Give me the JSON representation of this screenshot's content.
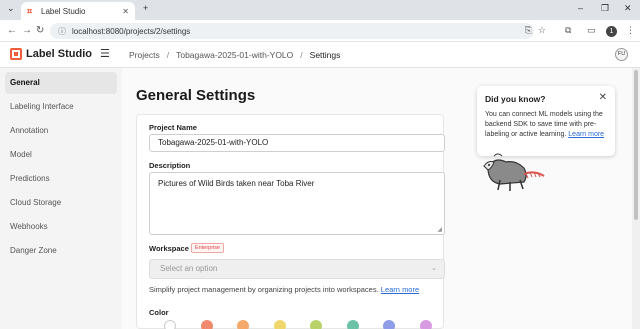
{
  "browser": {
    "tab_title": "Label Studio",
    "url": "localhost:8080/projects/2/settings",
    "profile_initial": "1"
  },
  "app": {
    "logo_text": "Label Studio",
    "breadcrumb": [
      "Projects",
      "Tobagawa-2025-01-with-YOLO",
      "Settings"
    ],
    "avatar_initials": "FU"
  },
  "sidebar": {
    "items": [
      {
        "label": "General",
        "active": true
      },
      {
        "label": "Labeling Interface"
      },
      {
        "label": "Annotation"
      },
      {
        "label": "Model"
      },
      {
        "label": "Predictions"
      },
      {
        "label": "Cloud Storage"
      },
      {
        "label": "Webhooks"
      },
      {
        "label": "Danger Zone"
      }
    ]
  },
  "main": {
    "title": "General Settings",
    "project_name_label": "Project Name",
    "project_name_value": "Tobagawa-2025-01-with-YOLO",
    "description_label": "Description",
    "description_value": "Pictures of Wild Birds taken near Toba River",
    "workspace_label": "Workspace",
    "workspace_badge": "Enterprise",
    "workspace_placeholder": "Select an option",
    "workspace_hint": "Simplify project management by organizing projects into workspaces.",
    "workspace_hint_link": "Learn more",
    "color_label": "Color",
    "colors": [
      "#ffffff",
      "#f08a6e",
      "#f4a96a",
      "#f0d76c",
      "#b9d36a",
      "#6cc2a6",
      "#8f9de8",
      "#d89ae0"
    ]
  },
  "tip": {
    "title": "Did you know?",
    "body": "You can connect ML models using the backend SDK to save time with pre-labeling or active learning.",
    "link": "Learn more"
  }
}
